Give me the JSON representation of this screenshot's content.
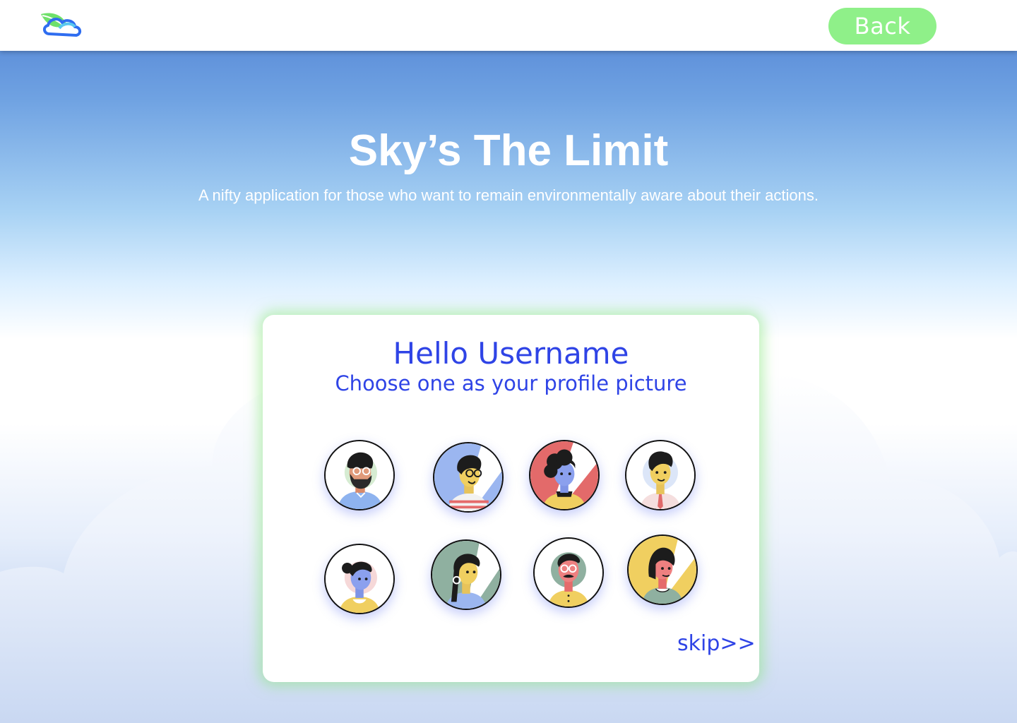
{
  "header": {
    "back_label": "Back",
    "logo_icon": "leaf-cloud-icon"
  },
  "hero": {
    "title": "Sky’s The Limit",
    "subtitle": "A nifty application for those who want to remain environmentally aware about their actions."
  },
  "card": {
    "greeting": "Hello Username",
    "prompt": "Choose one as your profile picture",
    "skip_label": "skip>>",
    "avatars": [
      {
        "icon": "avatar-bearded-man-icon"
      },
      {
        "icon": "avatar-glasses-man-icon"
      },
      {
        "icon": "avatar-curly-hair-woman-icon"
      },
      {
        "icon": "avatar-young-man-icon"
      },
      {
        "icon": "avatar-ponytail-woman-icon"
      },
      {
        "icon": "avatar-earring-woman-icon"
      },
      {
        "icon": "avatar-mustache-man-icon"
      },
      {
        "icon": "avatar-bob-hair-woman-icon"
      }
    ]
  },
  "colors": {
    "accent": "#2f44e6",
    "back_button": "#8ff089",
    "sky_top": "#4f80d3",
    "card_glow": "#8ce682"
  }
}
